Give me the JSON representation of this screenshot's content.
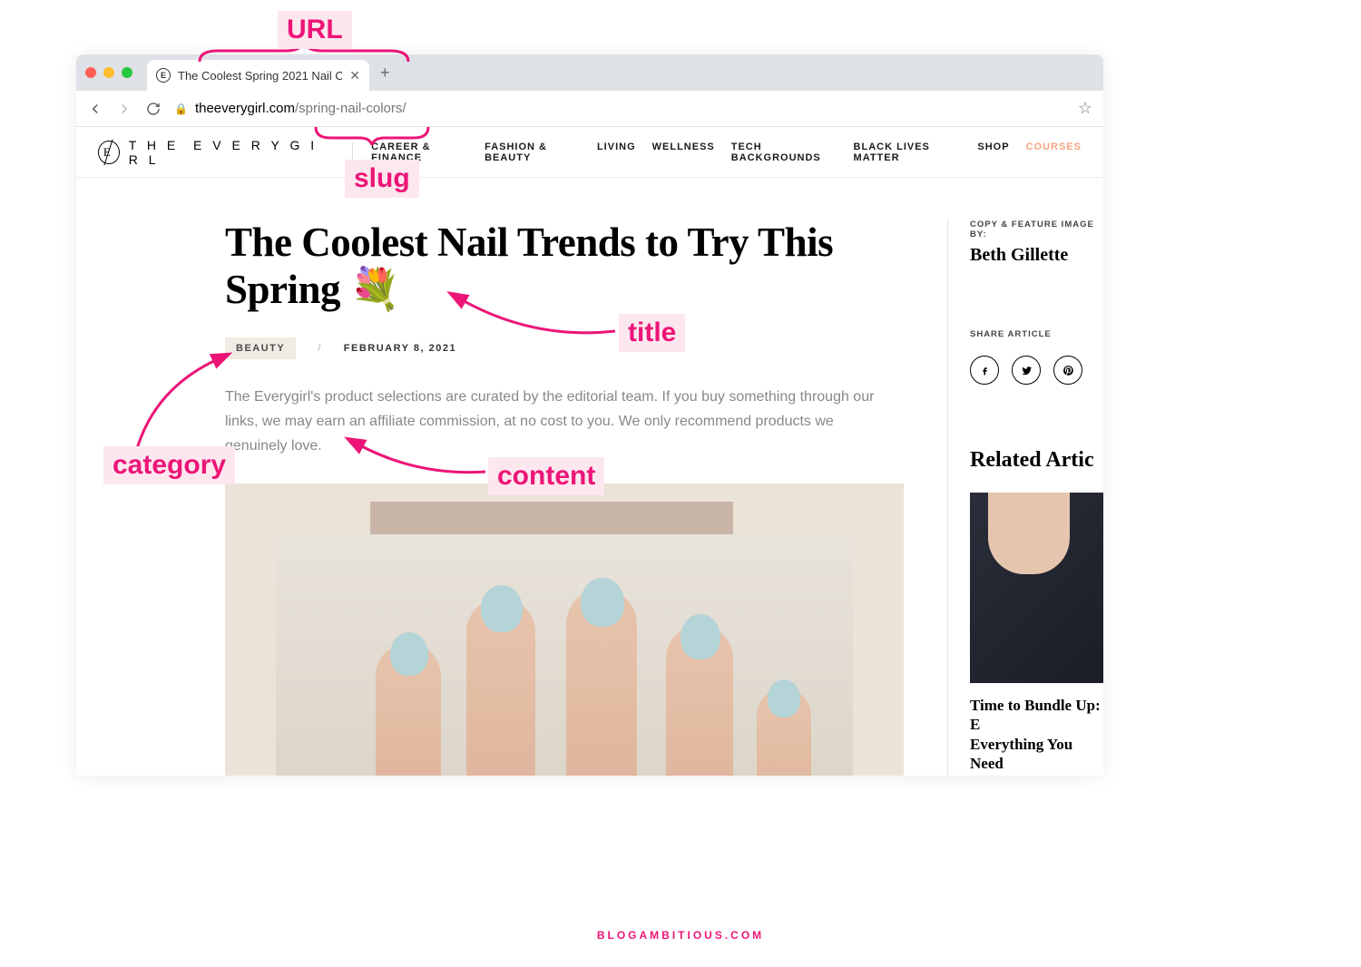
{
  "browser": {
    "tab_title": "The Coolest Spring 2021 Nail C",
    "url_domain": "theeverygirl.com",
    "url_path": "/spring-nail-colors/"
  },
  "site": {
    "logo_left": "T H E",
    "logo_right": "E V E R Y G I R L",
    "nav": [
      "CAREER & FINANCE",
      "FASHION & BEAUTY",
      "LIVING",
      "WELLNESS",
      "TECH BACKGROUNDS",
      "BLACK LIVES MATTER",
      "SHOP",
      "COURSES"
    ]
  },
  "article": {
    "title": "The Coolest Nail Trends to Try This Spring 💐",
    "category": "BEAUTY",
    "date": "FEBRUARY 8, 2021",
    "lead": "The Everygirl's product selections are curated by the editorial team. If you buy something through our links, we may earn an affiliate commission, at no cost to you. We only recommend products we genuinely love."
  },
  "sidebar": {
    "byline_label": "COPY & FEATURE IMAGE BY:",
    "author": "Beth Gillette",
    "share_label": "SHARE ARTICLE",
    "related_title": "Related Artic",
    "related_article": "Time to Bundle Up: E\nEverything You Need"
  },
  "annotations": {
    "url": "URL",
    "slug": "slug",
    "title": "title",
    "category": "category",
    "content": "content"
  },
  "footer": "BLOGAMBITIOUS.COM"
}
